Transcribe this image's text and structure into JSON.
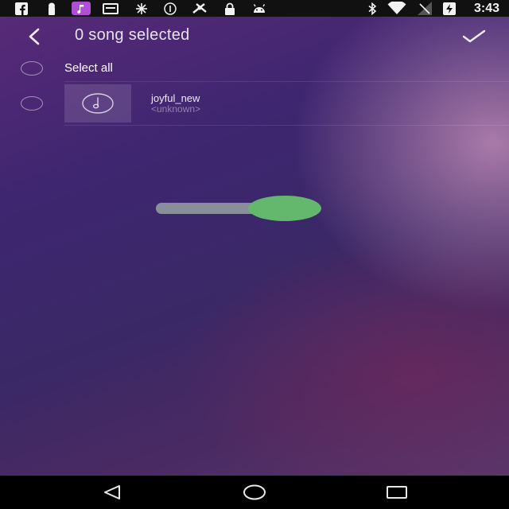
{
  "status_bar": {
    "time": "3:43",
    "icons_left": [
      "facebook-icon",
      "keyhole-icon",
      "music-note-icon",
      "inbox-icon",
      "brightness-icon",
      "info-icon",
      "fan-icon",
      "lock-icon",
      "android-icon"
    ],
    "icons_right": [
      "bluetooth-icon",
      "wifi-icon",
      "signal-icon",
      "battery-charging-icon"
    ]
  },
  "toolbar": {
    "title": "0 song selected"
  },
  "select_all": {
    "label": "Select all"
  },
  "songs": [
    {
      "title": "joyful_new",
      "artist": "<unknown>"
    }
  ],
  "slider": {
    "value": 0.5
  },
  "colors": {
    "accent": "#63b86e",
    "track": "#8a8e9a"
  }
}
